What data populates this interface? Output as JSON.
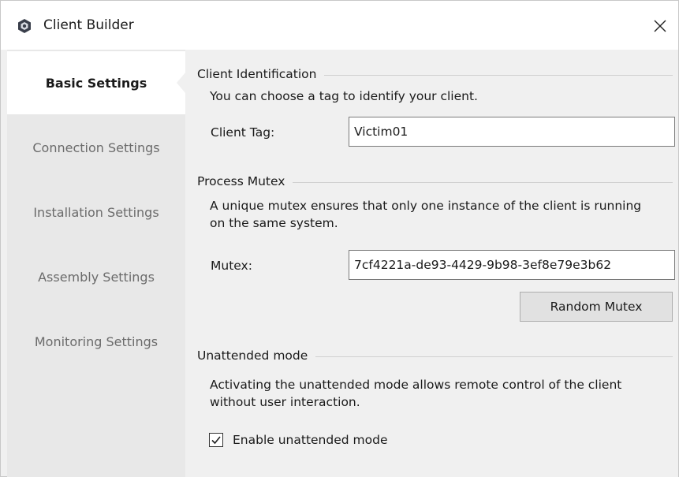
{
  "window": {
    "title": "Client Builder",
    "close_glyph": "✕"
  },
  "sidebar": {
    "items": [
      {
        "label": "Basic Settings",
        "active": true
      },
      {
        "label": "Connection Settings",
        "active": false
      },
      {
        "label": "Installation Settings",
        "active": false
      },
      {
        "label": "Assembly Settings",
        "active": false
      },
      {
        "label": "Monitoring Settings",
        "active": false
      }
    ]
  },
  "client_identification": {
    "heading": "Client Identification",
    "description": "You can choose a tag to identify your client.",
    "tag_label": "Client Tag:",
    "tag_value": "Victim01"
  },
  "process_mutex": {
    "heading": "Process Mutex",
    "description_line1": "A unique mutex ensures that only one instance of the client is running",
    "description_line2": "on the same system.",
    "mutex_label": "Mutex:",
    "mutex_value": "7cf4221a-de93-4429-9b98-3ef8e79e3b62",
    "random_button": "Random Mutex"
  },
  "unattended_mode": {
    "heading": "Unattended mode",
    "description_line1": "Activating the unattended mode allows remote control of the client",
    "description_line2": "without user interaction.",
    "checkbox_label": "Enable unattended mode",
    "checked": true
  },
  "colors": {
    "window_bg": "#f0f0f0",
    "sidebar_bg": "#e8e8e8",
    "active_bg": "#ffffff"
  }
}
